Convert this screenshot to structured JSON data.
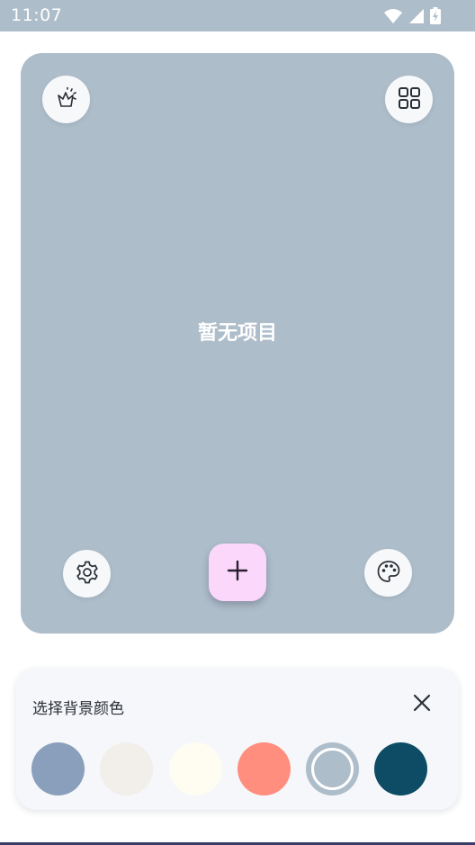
{
  "status_bar": {
    "time": "11:07",
    "icons": [
      "wifi-icon",
      "cellular-signal-icon",
      "battery-charging-icon"
    ],
    "background": "#aebdca"
  },
  "main": {
    "background": "#aebdca",
    "empty_message": "暂无项目",
    "buttons": {
      "top_left": "effects-icon",
      "top_right": "grid-view-icon",
      "bottom_left": "settings-icon",
      "bottom_center": "add-icon",
      "bottom_right": "palette-icon"
    },
    "fab_color": "#fbd7fc"
  },
  "color_sheet": {
    "title": "选择背景颜色",
    "close_icon": "close-icon",
    "swatches": [
      {
        "color": "#8a9fbb",
        "selected": false
      },
      {
        "color": "#f2eeea",
        "selected": false
      },
      {
        "color": "#fffcf2",
        "selected": false
      },
      {
        "color": "#ff8e7f",
        "selected": false
      },
      {
        "color": "#aebdca",
        "selected": true
      },
      {
        "color": "#0e4c65",
        "selected": false
      }
    ]
  }
}
